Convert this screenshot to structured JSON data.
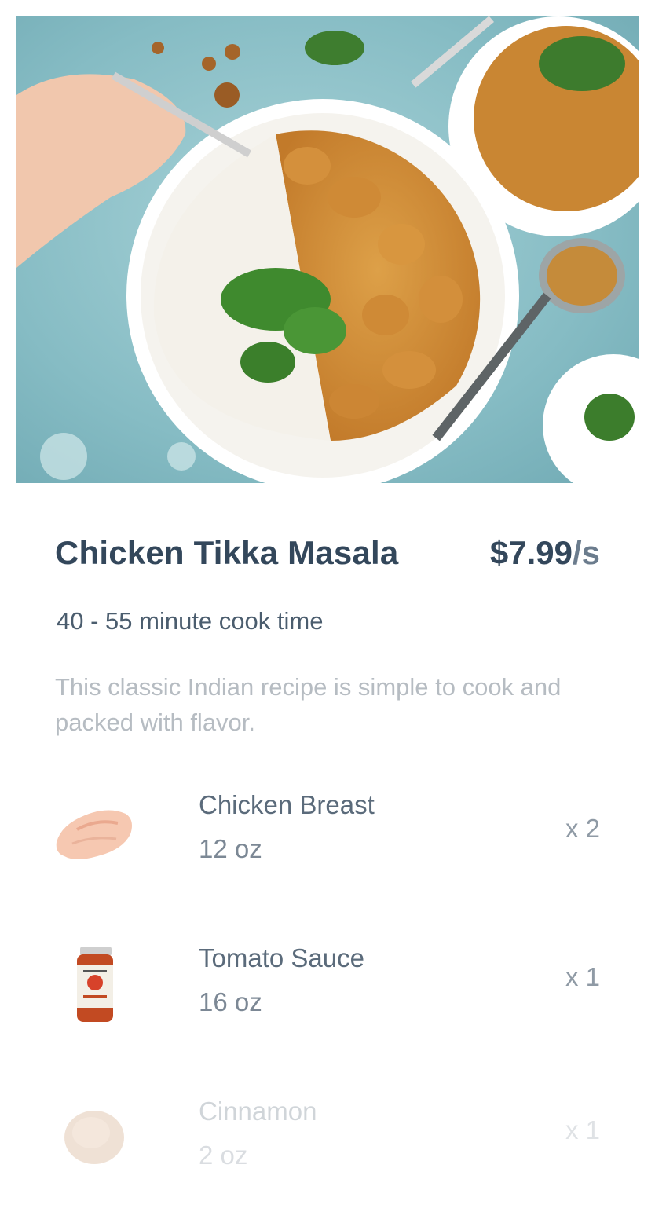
{
  "hero": {
    "image_icon": "chicken-tikka-masala-photo"
  },
  "recipe": {
    "title": "Chicken Tikka Masala",
    "price": "$7.99",
    "price_unit": "/s",
    "cook_time": "40 - 55 minute cook time",
    "description": "This classic Indian recipe is simple to cook and packed with flavor."
  },
  "ingredients": [
    {
      "name": "Chicken Breast",
      "size": "12 oz",
      "qty": "x 2",
      "icon": "chicken-breast-icon"
    },
    {
      "name": "Tomato Sauce",
      "size": "16 oz",
      "qty": "x 1",
      "icon": "tomato-sauce-jar-icon"
    },
    {
      "name": "Cinnamon",
      "size": "2 oz",
      "qty": "x 1",
      "icon": "cinnamon-powder-icon"
    }
  ],
  "colors": {
    "title": "#33475b",
    "price_unit": "#6b7c8d",
    "cook_time": "#4b5d6e",
    "description": "#b6bcc2",
    "hero_background": "#8fc0c7"
  }
}
